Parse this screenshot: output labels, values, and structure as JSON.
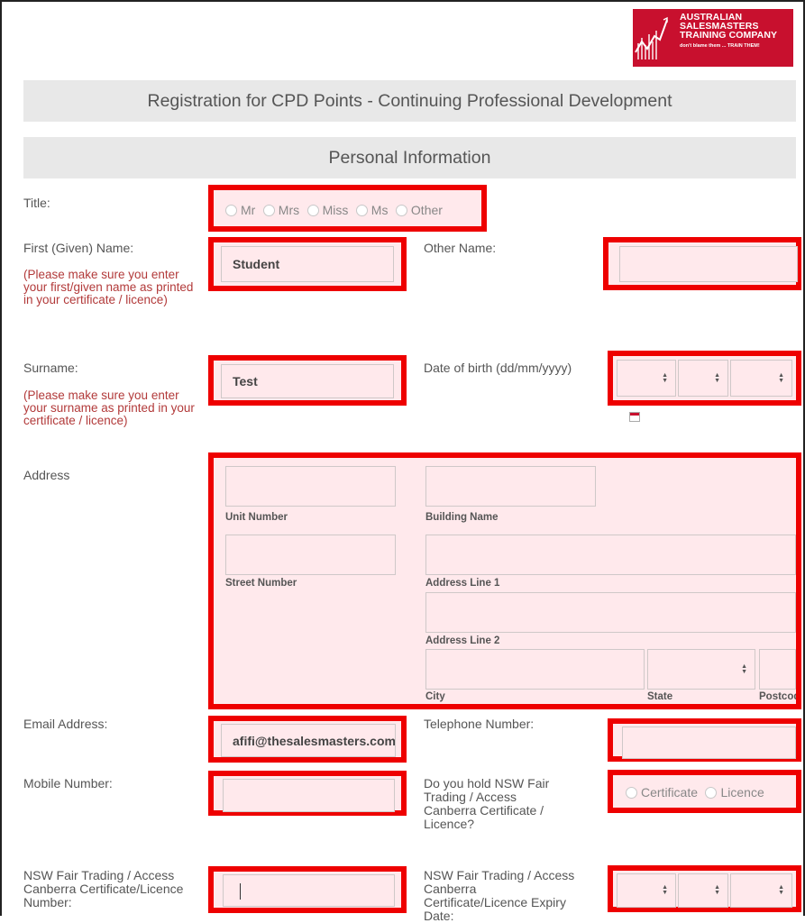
{
  "logo": {
    "lines": [
      "AUSTRALIAN",
      "SALESMASTERS",
      "TRAINING COMPANY"
    ],
    "tagline": "don't blame them ... TRAIN THEM!",
    "color": "#c8102e"
  },
  "page_title": "Registration for CPD Points - Continuing Professional Development",
  "section_title": "Personal Information",
  "highlight_color": "#ee0000",
  "title_field": {
    "label": "Title:",
    "options": [
      "Mr",
      "Mrs",
      "Miss",
      "Ms",
      "Other"
    ]
  },
  "first_name": {
    "label": "First (Given) Name:",
    "note": "(Please make sure you enter your first/given name as printed in your certificate / licence)",
    "value": "Student"
  },
  "other_name": {
    "label": "Other Name:",
    "value": ""
  },
  "surname": {
    "label": "Surname:",
    "note": "(Please make sure you enter your surname as printed in your certificate / licence)",
    "value": "Test"
  },
  "dob": {
    "label": "Date of birth (dd/mm/yyyy)",
    "icon": "calendar-icon"
  },
  "address": {
    "label": "Address",
    "unit_number": "Unit Number",
    "building_name": "Building Name",
    "street_number": "Street Number",
    "address_line_1": "Address Line 1",
    "address_line_2": "Address Line 2",
    "city": "City",
    "state": "State",
    "postcode": "Postcod"
  },
  "email": {
    "label": "Email Address:",
    "value": "afifi@thesalesmasters.com"
  },
  "telephone": {
    "label": "Telephone Number:",
    "value": ""
  },
  "mobile": {
    "label": "Mobile Number:",
    "value": ""
  },
  "holds_cert": {
    "label": "Do you hold NSW Fair Trading / Access Canberra Certificate / Licence?",
    "options": [
      "Certificate",
      "Licence"
    ]
  },
  "cert_number": {
    "label": "NSW Fair Trading / Access Canberra Certificate/Licence Number:",
    "value": ""
  },
  "cert_expiry": {
    "label": "NSW Fair Trading / Access Canberra Certificate/Licence Expiry Date:"
  }
}
